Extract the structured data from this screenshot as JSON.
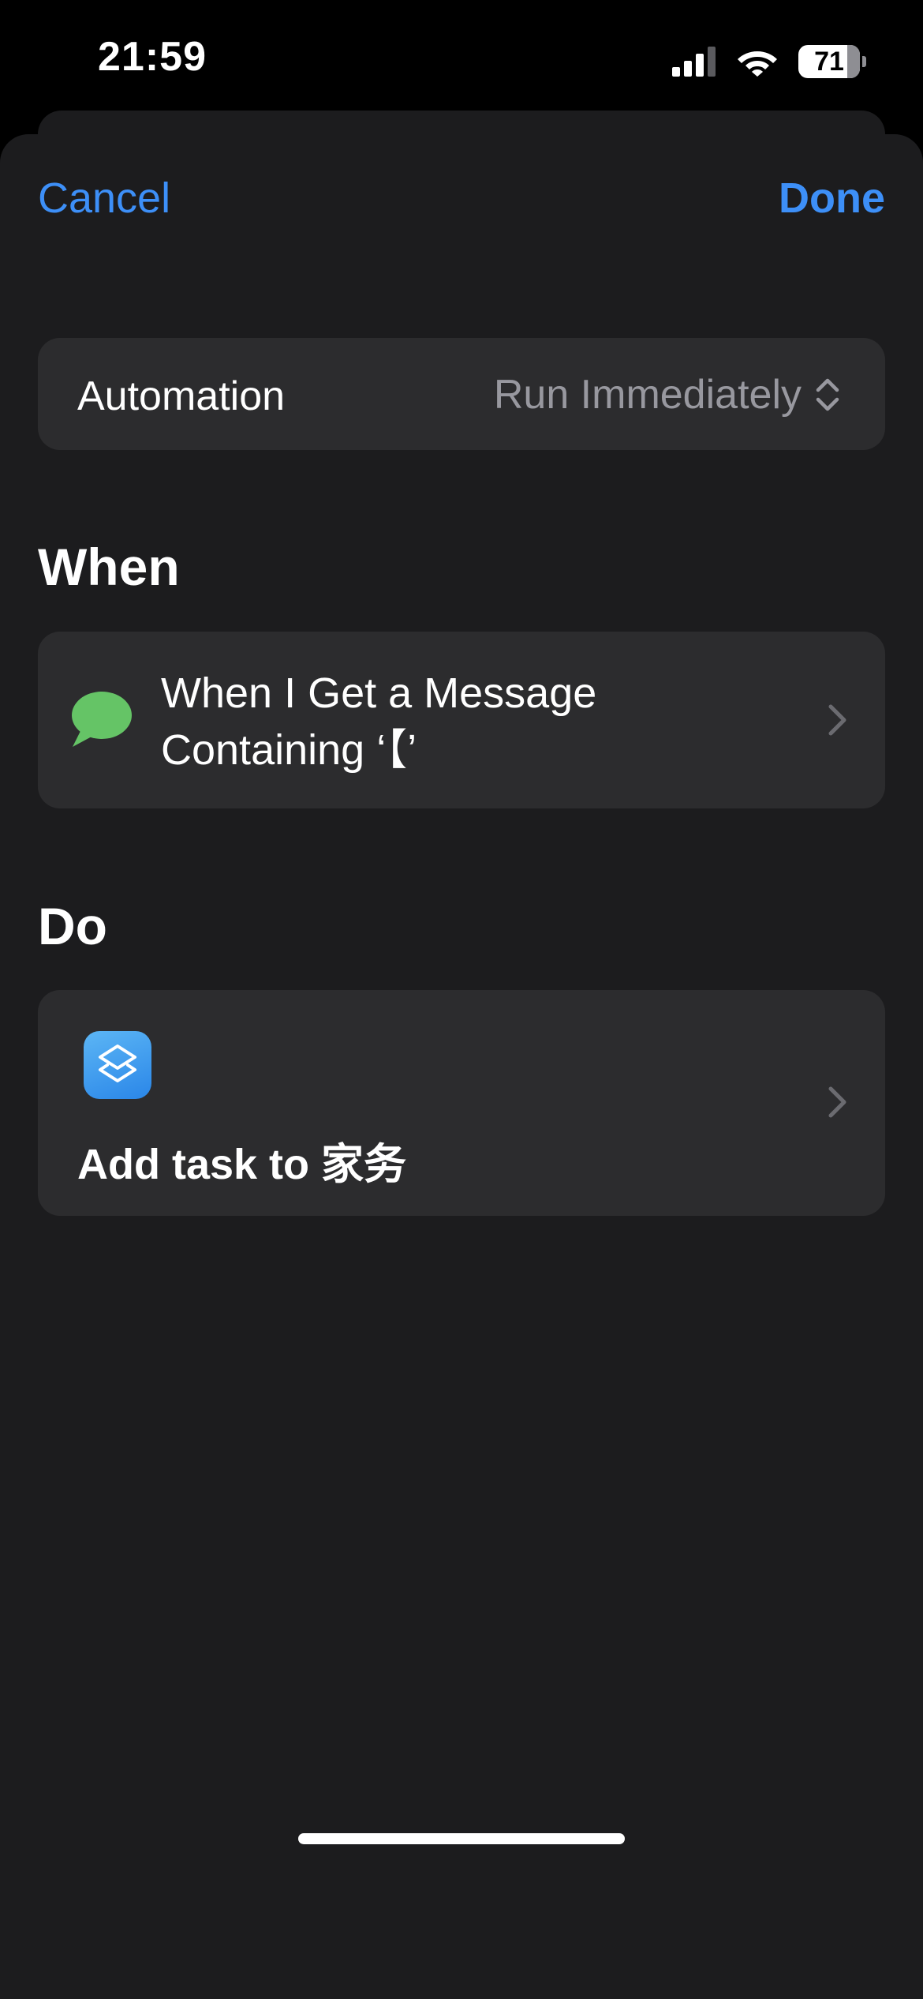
{
  "status_bar": {
    "time": "21:59",
    "battery": "71",
    "icons": [
      "cellular-signal-icon",
      "wifi-icon",
      "battery-icon"
    ]
  },
  "nav": {
    "cancel_label": "Cancel",
    "done_label": "Done"
  },
  "automation": {
    "label": "Automation",
    "value": "Run Immediately",
    "icon": "chevron-up-down-icon"
  },
  "when": {
    "title": "When",
    "trigger_line1": "When I Get a Message",
    "trigger_line2": "Containing ‘【’",
    "icon": "message-bubble-icon"
  },
  "do": {
    "title": "Do",
    "action_label": "Add task to 家务",
    "icon": "shortcuts-icon"
  },
  "colors": {
    "accent": "#3d8ff7",
    "sheet_bg": "#1c1c1e",
    "card_bg": "#2c2c2e",
    "secondary_text": "#98989f",
    "message_green": "#65c466"
  }
}
